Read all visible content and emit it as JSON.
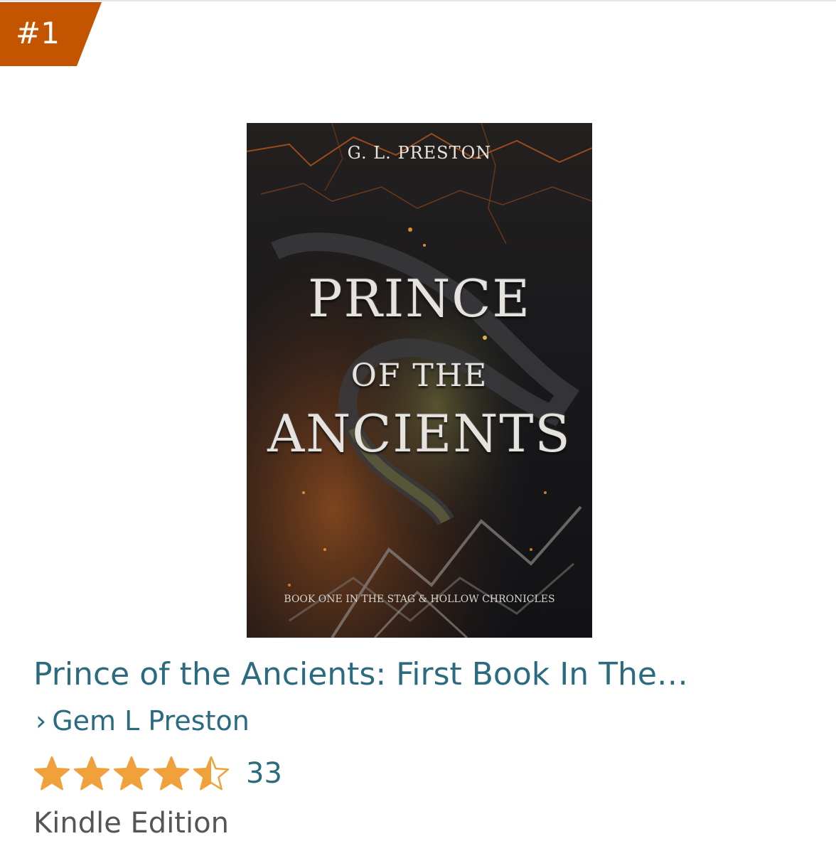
{
  "badge": {
    "rank": "#1",
    "color": "#c45500"
  },
  "cover": {
    "author": "G. L. PRESTON",
    "title_line1": "PRINCE",
    "title_line2": "OF THE",
    "title_line3": "ANCIENTS",
    "subtitle": "BOOK ONE IN THE STAG & HOLLOW CHRONICLES"
  },
  "product": {
    "title": "Prince of the Ancients: First Book In The…",
    "author_chevron": "›",
    "author": "Gem L Preston",
    "rating_stars": 4.5,
    "rating_max": 5,
    "rating_count": "33",
    "format": "Kindle Edition"
  },
  "colors": {
    "link": "#2b6b7f",
    "star": "#f0a13c",
    "text_secondary": "#555555"
  }
}
